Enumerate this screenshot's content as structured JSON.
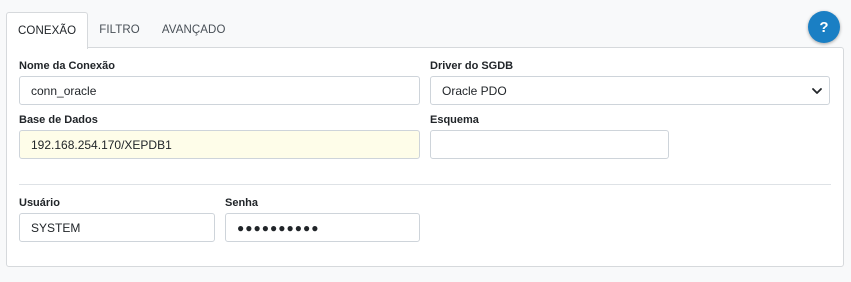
{
  "tabs": [
    {
      "label": "CONEXÃO",
      "active": true
    },
    {
      "label": "FILTRO",
      "active": false
    },
    {
      "label": "AVANÇADO",
      "active": false
    }
  ],
  "help": {
    "label": "?",
    "icon": "help-icon",
    "color": "#1a7fc4"
  },
  "form": {
    "connection_name": {
      "label": "Nome da Conexão",
      "value": "conn_oracle"
    },
    "driver": {
      "label": "Driver do SGDB",
      "value": "Oracle PDO",
      "icon": "chevron-down-icon"
    },
    "database": {
      "label": "Base de Dados",
      "value": "192.168.254.170/XEPDB1"
    },
    "schema": {
      "label": "Esquema",
      "value": ""
    },
    "user": {
      "label": "Usuário",
      "value": "SYSTEM"
    },
    "password": {
      "label": "Senha",
      "value": "●●●●●●●●●●"
    }
  },
  "colors": {
    "highlight_field_bg": "#fefde9",
    "border": "#ced4da"
  }
}
